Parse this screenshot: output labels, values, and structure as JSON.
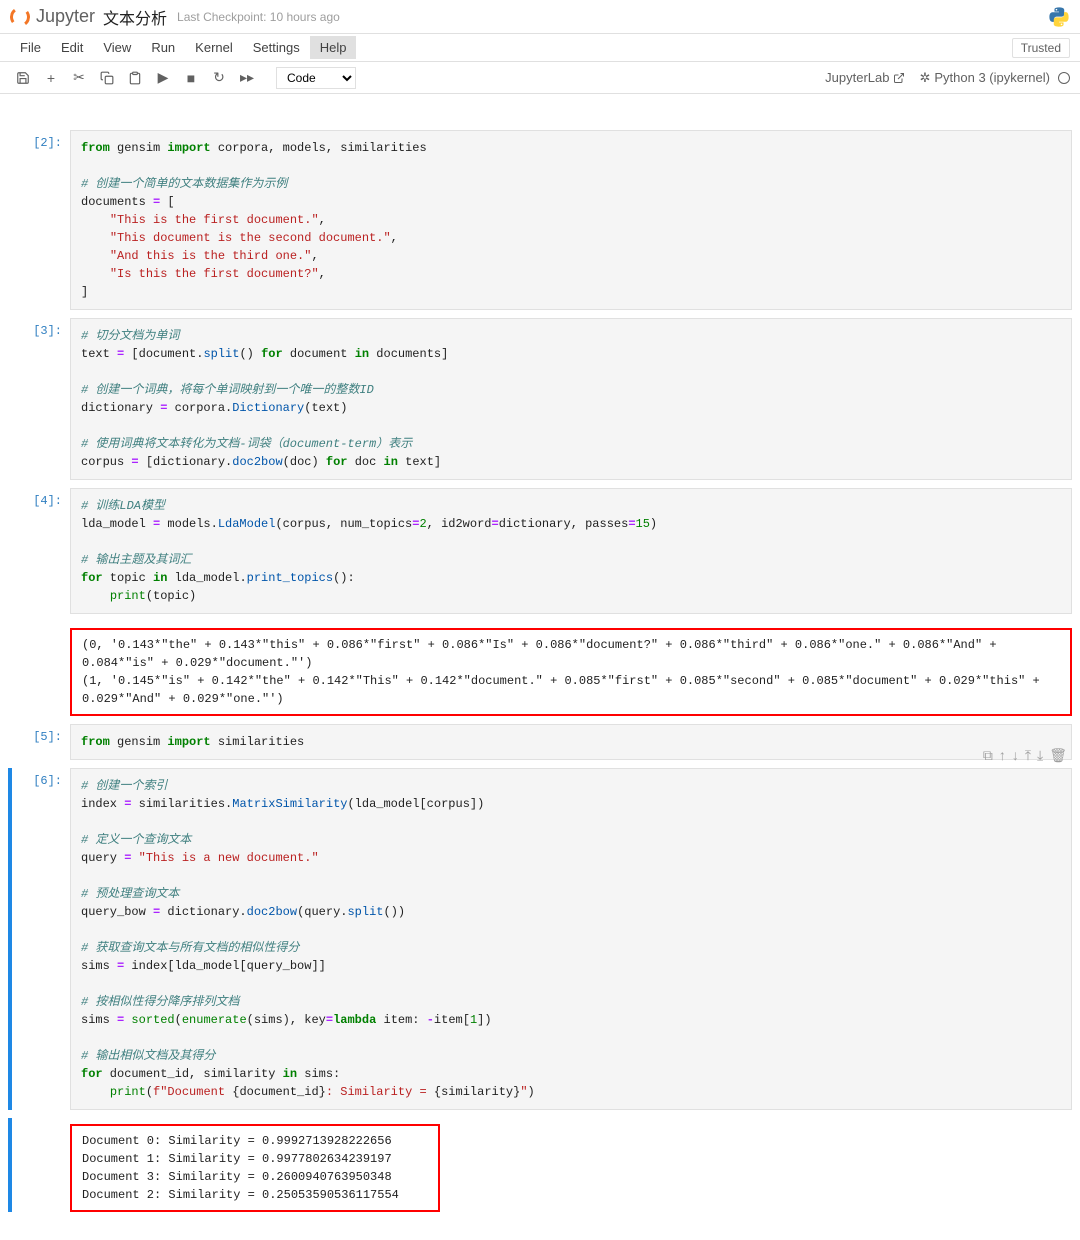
{
  "header": {
    "logo_text": "Jupyter",
    "title": "文本分析",
    "checkpoint": "Last Checkpoint: 10 hours ago"
  },
  "menu": {
    "items": [
      "File",
      "Edit",
      "View",
      "Run",
      "Kernel",
      "Settings",
      "Help"
    ],
    "trusted": "Trusted"
  },
  "toolbar": {
    "code_selector": "Code",
    "jupyterlab": "JupyterLab",
    "kernel": "Python 3 (ipykernel)"
  },
  "cells": [
    {
      "prompt": "[2]:",
      "code_html": "<span class='kw'>from</span> gensim <span class='kw'>import</span> corpora, models, similarities\n\n<span class='cm'># 创建一个简单的文本数据集作为示例</span>\ndocuments <span class='op'>=</span> [\n    <span class='st'>\"This is the first document.\"</span>,\n    <span class='st'>\"This document is the second document.\"</span>,\n    <span class='st'>\"And this is the third one.\"</span>,\n    <span class='st'>\"Is this the first document?\"</span>,\n]"
    },
    {
      "prompt": "[3]:",
      "code_html": "<span class='cm'># 切分文档为单词</span>\ntext <span class='op'>=</span> [document.<span class='fn'>split</span>() <span class='kw'>for</span> document <span class='kw'>in</span> documents]\n\n<span class='cm'># 创建一个词典，将每个单词映射到一个唯一的整数ID</span>\ndictionary <span class='op'>=</span> corpora.<span class='fn'>Dictionary</span>(text)\n\n<span class='cm'># 使用词典将文本转化为文档-词袋（document-term）表示</span>\ncorpus <span class='op'>=</span> [dictionary.<span class='fn'>doc2bow</span>(doc) <span class='kw'>for</span> doc <span class='kw'>in</span> text]"
    },
    {
      "prompt": "[4]:",
      "code_html": "<span class='cm'># 训练LDA模型</span>\nlda_model <span class='op'>=</span> models.<span class='fn'>LdaModel</span>(corpus, num_topics<span class='op'>=</span><span class='num'>2</span>, id2word<span class='op'>=</span>dictionary, passes<span class='op'>=</span><span class='num'>15</span>)\n\n<span class='cm'># 输出主题及其词汇</span>\n<span class='kw'>for</span> topic <span class='kw'>in</span> lda_model.<span class='fn'>print_topics</span>():\n    <span class='nb'>print</span>(topic)",
      "output_text": "(0, '0.143*\"the\" + 0.143*\"this\" + 0.086*\"first\" + 0.086*\"Is\" + 0.086*\"document?\" + 0.086*\"third\" + 0.086*\"one.\" + 0.086*\"And\" + 0.084*\"is\" + 0.029*\"document.\"')\n(1, '0.145*\"is\" + 0.142*\"the\" + 0.142*\"This\" + 0.142*\"document.\" + 0.085*\"first\" + 0.085*\"second\" + 0.085*\"document\" + 0.029*\"this\" + 0.029*\"And\" + 0.029*\"one.\"')",
      "output_red": true
    },
    {
      "prompt": "[5]:",
      "code_html": "<span class='kw'>from</span> gensim <span class='kw'>import</span> similarities"
    },
    {
      "prompt": "[6]:",
      "selected": true,
      "show_cell_toolbar": true,
      "code_html": "<span class='cm'># 创建一个索引</span>\nindex <span class='op'>=</span> similarities.<span class='fn'>MatrixSimilarity</span>(lda_model[corpus])\n\n<span class='cm'># 定义一个查询文本</span>\nquery <span class='op'>=</span> <span class='st'>\"This is a new document.\"</span>\n\n<span class='cm'># 预处理查询文本</span>\nquery_bow <span class='op'>=</span> dictionary.<span class='fn'>doc2bow</span>(query.<span class='fn'>split</span>())\n\n<span class='cm'># 获取查询文本与所有文档的相似性得分</span>\nsims <span class='op'>=</span> index[lda_model[query_bow]]\n\n<span class='cm'># 按相似性得分降序排列文档</span>\nsims <span class='op'>=</span> <span class='nb'>sorted</span>(<span class='nb'>enumerate</span>(sims), key<span class='op'>=</span><span class='kw'>lambda</span> item: <span class='op'>-</span>item[<span class='num'>1</span>])\n\n<span class='cm'># 输出相似文档及其得分</span>\n<span class='kw'>for</span> document_id, similarity <span class='kw'>in</span> sims:\n    <span class='nb'>print</span>(<span class='sf'>f\"Document </span>{document_id}<span class='sf'>: Similarity = </span>{similarity}<span class='sf'>\"</span>)",
      "output_text": "Document 0: Similarity = 0.9992713928222656\nDocument 1: Similarity = 0.9977802634239197\nDocument 3: Similarity = 0.2600940763950348\nDocument 2: Similarity = 0.25053590536117554",
      "output_red": true,
      "output_selected": true
    }
  ]
}
